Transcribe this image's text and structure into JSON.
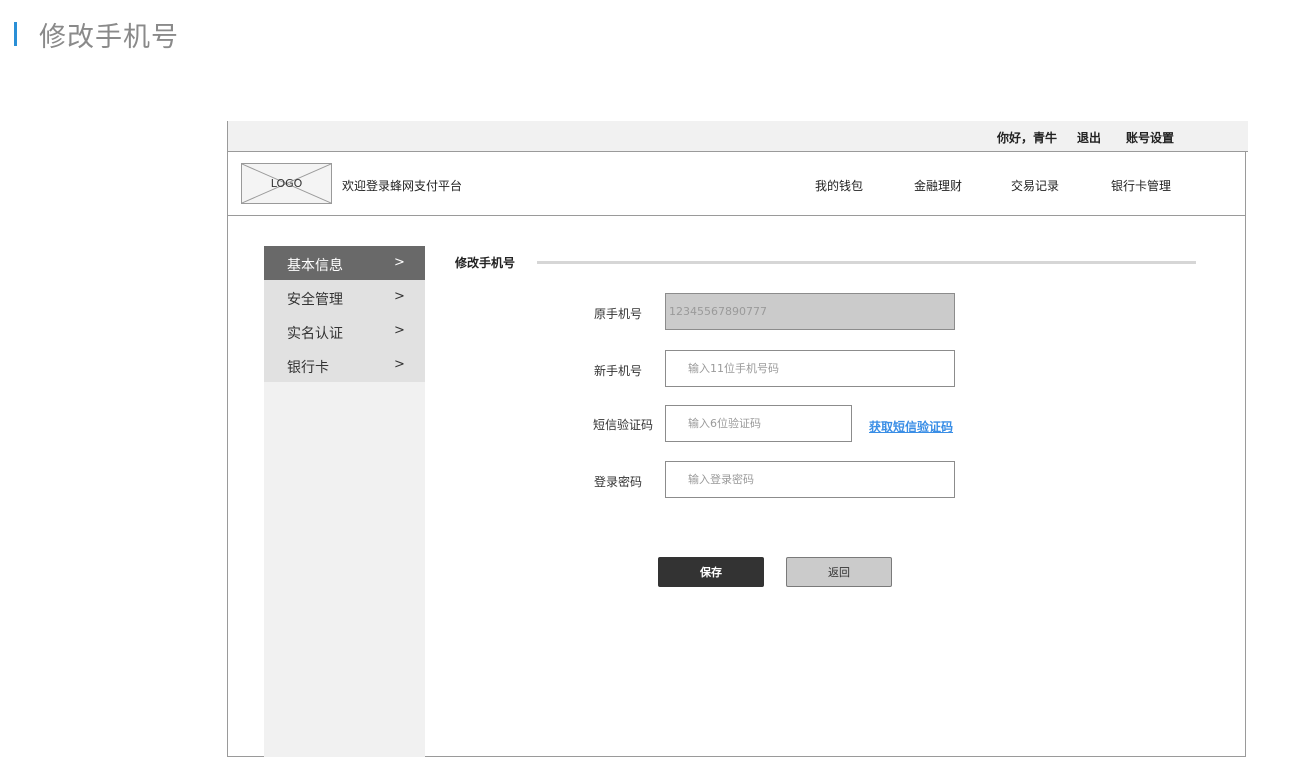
{
  "page": {
    "title": "修改手机号",
    "accent_color": "#2a8fd6"
  },
  "topbar": {
    "greeting": "你好，青牛",
    "logout": "退出",
    "account_settings": "账号设置"
  },
  "header": {
    "logo_text": "LOGO",
    "welcome": "欢迎登录蜂网支付平台",
    "nav": [
      "我的钱包",
      "金融理财",
      "交易记录",
      "银行卡管理"
    ]
  },
  "sidebar": {
    "items": [
      {
        "label": "基本信息",
        "chevron": ">"
      },
      {
        "label": "安全管理",
        "chevron": ">"
      },
      {
        "label": "实名认证",
        "chevron": ">"
      },
      {
        "label": "银行卡",
        "chevron": ">"
      }
    ]
  },
  "form": {
    "section_title": "修改手机号",
    "old_phone": {
      "label": "原手机号",
      "value": "12345567890777"
    },
    "new_phone": {
      "label": "新手机号",
      "placeholder": "输入11位手机号码"
    },
    "sms_code": {
      "label": "短信验证码",
      "placeholder": "输入6位验证码",
      "link": "获取短信验证码"
    },
    "password": {
      "label": "登录密码",
      "placeholder": "输入登录密码"
    },
    "save_label": "保存",
    "back_label": "返回"
  }
}
